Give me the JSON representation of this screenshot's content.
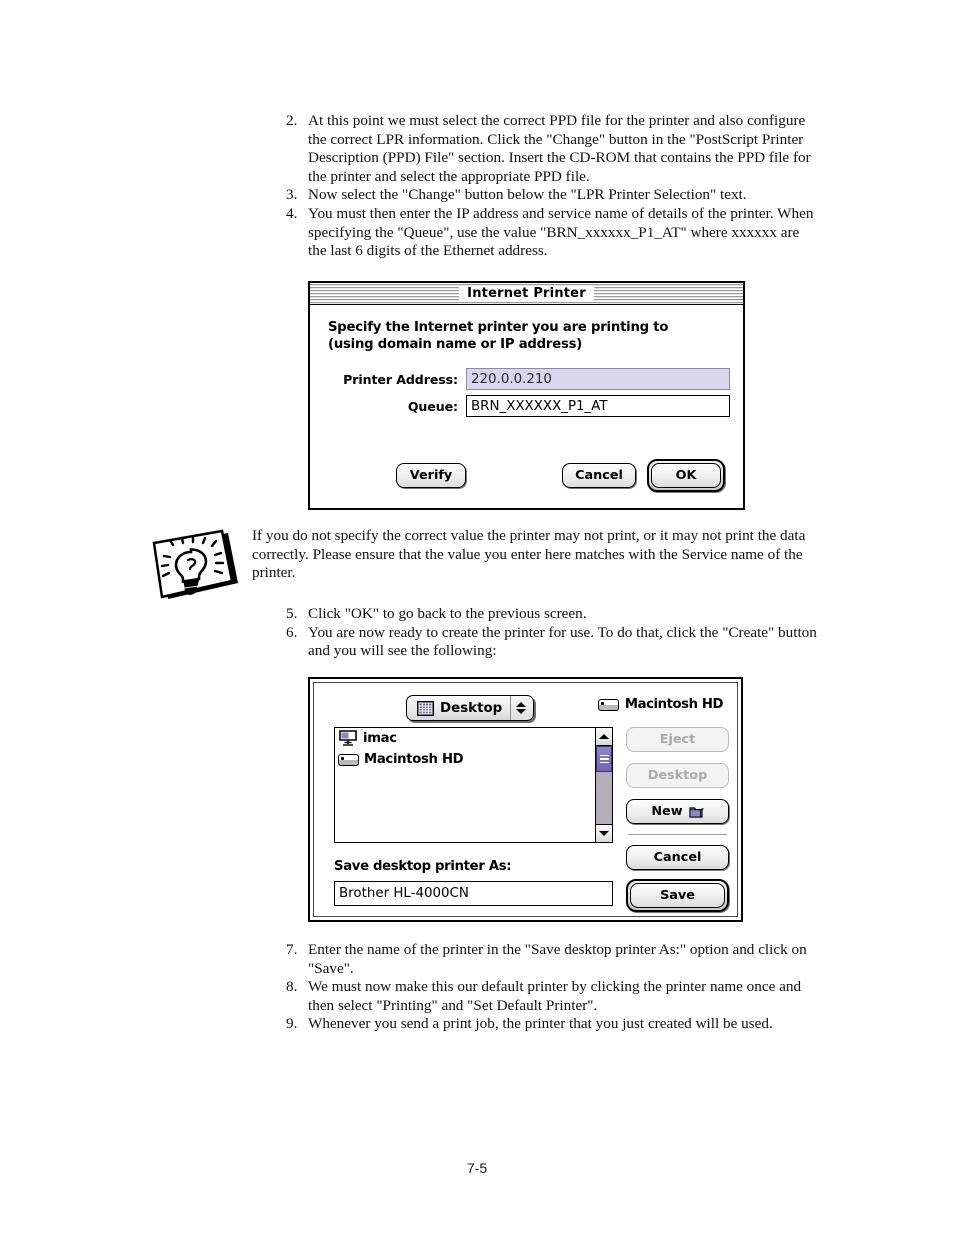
{
  "document": {
    "page_number": "7-5",
    "steps_top": [
      {
        "num": "2.",
        "text": "At this point we must select the correct PPD file for the printer and also configure the correct LPR information. Click the \"Change\" button in the \"PostScript Printer Description (PPD) File\" section. Insert the CD-ROM that contains the PPD file for the printer and select the appropriate PPD file."
      },
      {
        "num": "3.",
        "text": "Now select the \"Change\" button below the \"LPR Printer Selection\" text."
      },
      {
        "num": "4.",
        "text": "You must then enter the IP address and service name of details of the printer. When specifying the \"Queue\", use the value \"BRN_xxxxxx_P1_AT\" where xxxxxx are the last 6 digits of the Ethernet address."
      }
    ],
    "note": {
      "icon": "note-lightbulb-icon",
      "text": "If you do not specify the correct value the printer may not print, or it may not print the data correctly. Please ensure that the value you enter here matches with the Service name of the printer."
    },
    "steps_mid": [
      {
        "num": "5.",
        "text": "Click \"OK\" to go back to the previous screen."
      },
      {
        "num": "6.",
        "text": "You are now ready to create the printer for use. To do that, click the \"Create\" button and you will see the following:"
      }
    ],
    "steps_bottom": [
      {
        "num": "7.",
        "text": "Enter the name of the printer in the \"Save desktop printer As:\" option and click on \"Save\"."
      },
      {
        "num": "8.",
        "text": "We must now make this our default printer by clicking the printer name once and then select \"Printing\" and \"Set Default Printer\"."
      },
      {
        "num": "9.",
        "text": "Whenever you send a print job, the printer that you just created will be used."
      }
    ]
  },
  "internet_printer_dialog": {
    "title": "Internet Printer",
    "heading_line1": "Specify the Internet printer you are printing to",
    "heading_line2": "(using domain name or IP address)",
    "fields": [
      {
        "label": "Printer Address:",
        "value": "220.0.0.210",
        "selected": true
      },
      {
        "label": "Queue:",
        "value": "BRN_XXXXXX_P1_AT",
        "selected": false
      }
    ],
    "buttons": {
      "verify": "Verify",
      "cancel": "Cancel",
      "ok": "OK"
    },
    "colors": {
      "selected_field_bg": "#d9d5ec",
      "title_bar_stripe": "#9a9a9a"
    }
  },
  "save_dialog": {
    "location_popup": {
      "label": "Desktop",
      "icon": "desktop-grid-icon"
    },
    "volume_label": {
      "text": "Macintosh HD",
      "icon": "hard-drive-icon"
    },
    "file_list": [
      {
        "name": "imac",
        "icon": "imac-computer-icon"
      },
      {
        "name": "Macintosh HD",
        "icon": "hard-drive-icon"
      }
    ],
    "buttons": {
      "eject": "Eject",
      "desktop": "Desktop",
      "new": "New",
      "cancel": "Cancel",
      "save": "Save"
    },
    "save_as_label": "Save desktop printer As:",
    "save_as_value": "Brother HL-4000CN",
    "colors": {
      "scroll_thumb": "#7d76bd",
      "scroll_track": "#b3aeb8",
      "disabled_text": "#a9a9a9"
    }
  }
}
